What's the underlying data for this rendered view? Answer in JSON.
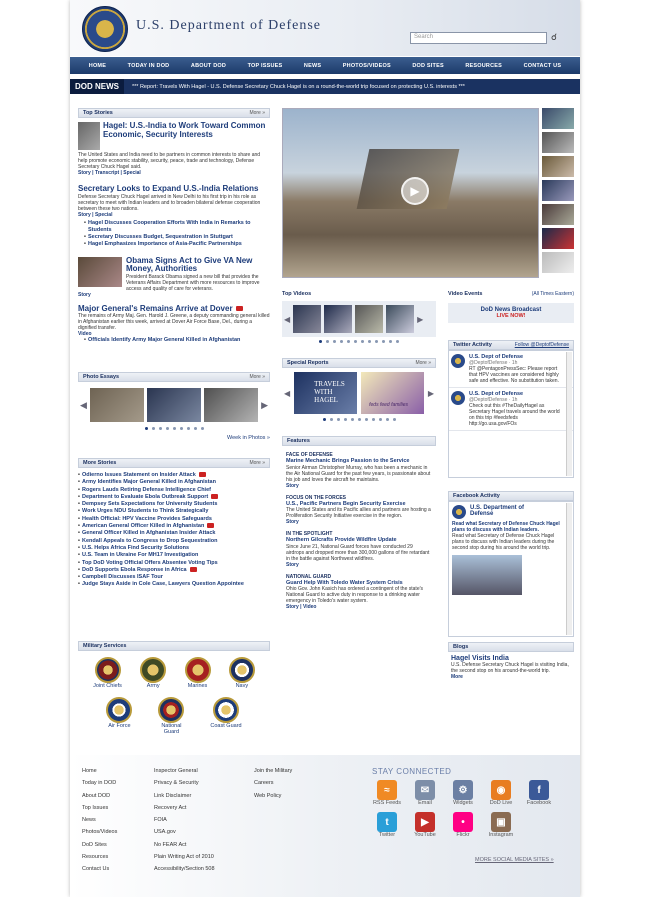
{
  "header": {
    "title": "U.S. Department of Defense",
    "search_placeholder": "Search"
  },
  "nav": [
    "HOME",
    "TODAY IN DOD",
    "ABOUT DOD",
    "TOP ISSUES",
    "NEWS",
    "PHOTOS/VIDEOS",
    "DOD SITES",
    "RESOURCES",
    "CONTACT US"
  ],
  "ticker": {
    "label": "DOD NEWS",
    "text": "*** Report: Travels With Hagel - U.S. Defense Secretary Chuck Hagel is on a round-the-world trip focused on protecting U.S. interests ***"
  },
  "top_stories": {
    "heading": "Top Stories",
    "more": "More »",
    "s1_title": "Hagel: U.S.-India to Work Toward Common Economic, Security Interests",
    "s1_body": "The United States and India need to be partners in common interests to share and help promote economic stability, security, peace, trade and technology, Defense Secretary Chuck Hagel said.",
    "s1_links": "Story | Transcript | Special",
    "s2_title": "Secretary Looks to Expand U.S.-India Relations",
    "s2_body": "Defense Secretary Chuck Hagel arrived in New Delhi to his first trip in his role as secretary to meet with Indian leaders and to broaden bilateral defense cooperation between these two nations.",
    "s2_links": "Story | Special",
    "s2_bullets": [
      "Hagel Discusses Cooperation Efforts With India in Remarks to Students",
      "Secretary Discusses Budget, Sequestration in Stuttgart",
      "Hagel Emphasizes Importance of Asia-Pacific Partnerships"
    ],
    "s3_title": "Obama Signs Act to Give VA New Money, Authorities",
    "s3_body": "President Barack Obama signed a new bill that provides the Veterans Affairs Department with more resources to improve access and quality of care for veterans.",
    "s3_links": "Story",
    "s4_title": "Major General's Remains Arrive at Dover",
    "s4_body": "The remains of Army Maj. Gen. Harold J. Greene, a deputy commanding general killed in Afghanistan earlier this week, arrived at Dover Air Force Base, Del., during a dignified transfer.",
    "s4_links": "Video",
    "s4_bullet": "Officials Identify Army Major General Killed in Afghanistan"
  },
  "photo_essays": {
    "heading": "Photo Essays",
    "more": "More »",
    "week": "Week in Photos »"
  },
  "more_stories": {
    "heading": "More Stories",
    "more": "More »",
    "items": [
      "Odierno Issues Statement on Insider Attack",
      "Army Identifies Major General Killed in Afghanistan",
      "Rogers Lauds Retiring Defense Intelligence Chief",
      "Department to Evaluate Ebola Outbreak Support",
      "Dempsey Sets Expectations for University Students",
      "Work Urges NDU Students to Think Strategically",
      "Health Official: HPV Vaccine Provides Safeguards",
      "American General Officer Killed in Afghanistan",
      "General Officer Killed in Afghanistan Insider Attack",
      "Kendall Appeals to Congress to Drop Sequestration",
      "U.S. Helps Africa Find Security Solutions",
      "U.S. Team in Ukraine For MH17 Investigation",
      "Top DoD Voting Official Offers Absentee Voting Tips",
      "DoD Supports Ebola Response in Africa",
      "Campbell Discusses ISAF Tour",
      "Judge Stays Aside in Cole Case, Lawyers Question Appointee"
    ]
  },
  "military_services": {
    "heading": "Military Services",
    "items": [
      "Joint Chiefs",
      "Army",
      "Marines",
      "Navy",
      "Air Force",
      "National Guard",
      "Coast Guard"
    ]
  },
  "top_videos": {
    "heading": "Top Videos"
  },
  "special_reports": {
    "heading": "Special Reports",
    "more": "More »",
    "r1": "TRAVELS WITH HAGEL",
    "r2": "feds feed families"
  },
  "features": {
    "heading": "Features",
    "f1_head": "FACE OF DEFENSE",
    "f1_title": "Marine Mechanic Brings Passion to the Service",
    "f1_body": "Senior Airman Christopher Murray, who has been a mechanic in the Air National Guard for the past few years, is passionate about his job and loves the aircraft he maintains.",
    "f1_link": "Story",
    "f2_head": "FOCUS ON THE FORCES",
    "f2_title": "U.S., Pacific Partners Begin Security Exercise",
    "f2_body": "The United States and its Pacific allies and partners are hosting a Proliferation Security Initiative exercise in the region.",
    "f2_link": "Story",
    "f3_head": "IN THE SPOTLIGHT",
    "f3_title": "Northern Gilcrafts Provide Wildfire Update",
    "f3_body": "Since June 21, National Guard forces have conducted 29 airdrops and dropped more than 300,000 gallons of fire retardant in the battle against Northwest wildfires.",
    "f3_link": "Story",
    "f4_head": "NATIONAL GUARD",
    "f4_title": "Guard Help With Toledo Water System Crisis",
    "f4_body": "Ohio Gov. John Kasich has ordered a contingent of the state's National Guard to active duty in response to a drinking water emergency in Toledo's water system.",
    "f4_links": "Story | Video"
  },
  "video_events": {
    "heading": "Video Events",
    "time": "(All Times Eastern)",
    "title": "DoD News Broadcast",
    "live": "LIVE NOW!"
  },
  "twitter": {
    "heading": "Twitter Activity",
    "follow": "Follow @DeptofDefense",
    "tweets": [
      {
        "name": "U.S. Dept of Defense",
        "handle": "@DeptofDefense · 1h",
        "text": "RT @PentagonPressSec: Please report that HPV vaccines are considered highly safe and effective. No substitution taken."
      },
      {
        "name": "U.S. Dept of Defense",
        "handle": "@DeptofDefense · 1h",
        "text": "Check out this #TheDailyHagel as Secretary Hagel travels around the world on this trip #feedsfeds http://go.usa.gov/FOs"
      }
    ]
  },
  "facebook": {
    "heading": "Facebook Activity",
    "name": "U.S. Department of Defense",
    "post_title": "Read what Secretary of Defense Chuck Hagel plans to discuss with Indian leaders.",
    "post_body": "Read what Secretary of Defense Chuck Hagel plans to discuss with Indian leaders during the second stop during his around the world trip."
  },
  "blogs": {
    "heading": "Blogs",
    "title": "Hagel Visits India",
    "body": "U.S. Defense Secretary Chuck Hagel is visiting India, the second stop on his around-the-world trip.",
    "more": "More"
  },
  "footer": {
    "col1": [
      "Home",
      "Today in DOD",
      "About DOD",
      "Top Issues",
      "News",
      "Photos/Videos",
      "DoD Sites",
      "Resources",
      "Contact Us"
    ],
    "col2": [
      "Inspector General",
      "Privacy & Security",
      "Link Disclaimer",
      "Recovery Act",
      "FOIA",
      "USA.gov",
      "No FEAR Act",
      "Plain Writing Act of 2010",
      "Accessibility/Section 508"
    ],
    "col3": [
      "Join the Military",
      "Careers",
      "Web Policy"
    ],
    "stay": "STAY CONNECTED",
    "social": [
      "RSS Feeds",
      "Email",
      "Widgets",
      "DoD Live",
      "Facebook",
      "Twitter",
      "YouTube",
      "Flickr",
      "Instagram"
    ],
    "more_social": "MORE SOCIAL MEDIA SITES »",
    "social_colors": [
      "#f08a24",
      "#7d8ea8",
      "#6b7fa3",
      "#e87d22",
      "#3b5998",
      "#2a9fd8",
      "#c4302b",
      "#ff0084",
      "#8a6b52"
    ]
  }
}
